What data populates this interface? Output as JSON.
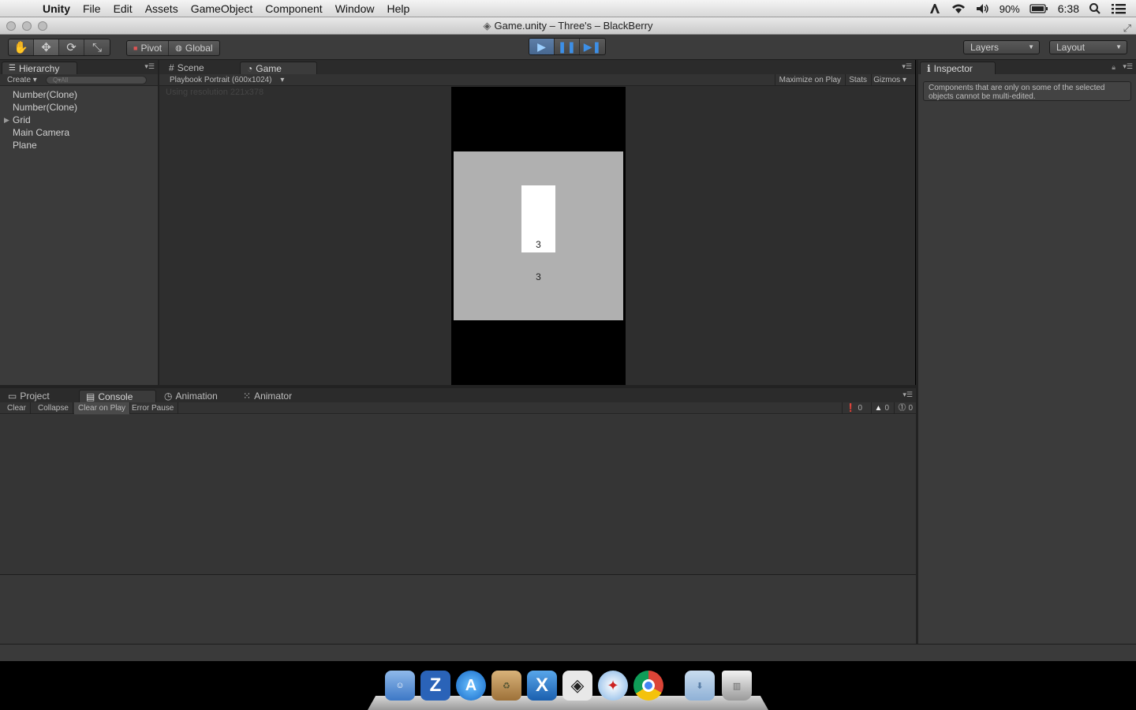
{
  "menubar": {
    "app": "Unity",
    "items": [
      "File",
      "Edit",
      "Assets",
      "GameObject",
      "Component",
      "Window",
      "Help"
    ],
    "battery": "90%",
    "time": "6:38"
  },
  "window": {
    "title": "Game.unity – Three's – BlackBerry"
  },
  "toolbar": {
    "pivot": "Pivot",
    "global": "Global",
    "layers": "Layers",
    "layout": "Layout"
  },
  "hierarchy": {
    "tab": "Hierarchy",
    "create": "Create",
    "search_placeholder": "Q▾All",
    "items": [
      "Number(Clone)",
      "Number(Clone)",
      "Grid",
      "Main Camera",
      "Plane"
    ]
  },
  "scene_tabs": {
    "scene": "Scene",
    "game": "Game"
  },
  "game": {
    "aspect": "Playbook Portrait (600x1024)",
    "maximize": "Maximize on Play",
    "stats": "Stats",
    "gizmos": "Gizmos",
    "resolution_msg": "Using resolution 221x378",
    "card_value": "3",
    "next_value": "3"
  },
  "inspector": {
    "tab": "Inspector",
    "note": "Components that are only on some of the selected objects cannot be multi-edited."
  },
  "console": {
    "tabs": [
      "Project",
      "Console",
      "Animation",
      "Animator"
    ],
    "buttons": [
      "Clear",
      "Collapse",
      "Clear on Play",
      "Error Pause"
    ],
    "counts": {
      "info": "0",
      "warnings": "0",
      "errors": "0"
    }
  },
  "dock": {
    "apps": [
      "Finder",
      "FileZilla",
      "App Store",
      "Archive Utility",
      "Xcode",
      "Unity",
      "Safari",
      "Chrome",
      "Downloads",
      "Trash"
    ]
  },
  "colors": {
    "editor_bg": "#3b3b3b",
    "play_accent": "#3d8fe6",
    "game_board": "#b0b0b0"
  }
}
